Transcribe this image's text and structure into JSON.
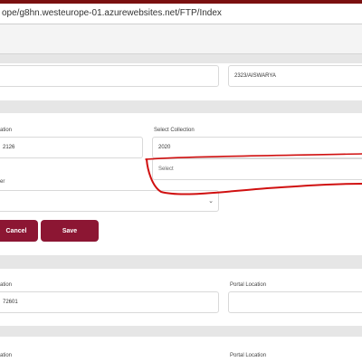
{
  "browser": {
    "url": "ope/g8hn.westeurope-01.azurewebsites.net/FTP/Index"
  },
  "section_top": {
    "value": "2323/AISWARYA"
  },
  "form": {
    "location_label": "ation",
    "location_value": "2126",
    "collection_label": "Select Collection",
    "collection_value": "2020",
    "select_placeholder": "Select",
    "filter_label": "er"
  },
  "buttons": {
    "cancel": "Cancel",
    "save": "Save"
  },
  "section_bottom_1": {
    "location_label": "ation",
    "location_value": "72601",
    "portal_label": "Portal Location"
  },
  "section_bottom_2": {
    "location_label": "ation",
    "portal_label": "Portal Location"
  },
  "colors": {
    "brand": "#8c1633",
    "annotation": "#d01010",
    "frame": "#7a1010"
  }
}
